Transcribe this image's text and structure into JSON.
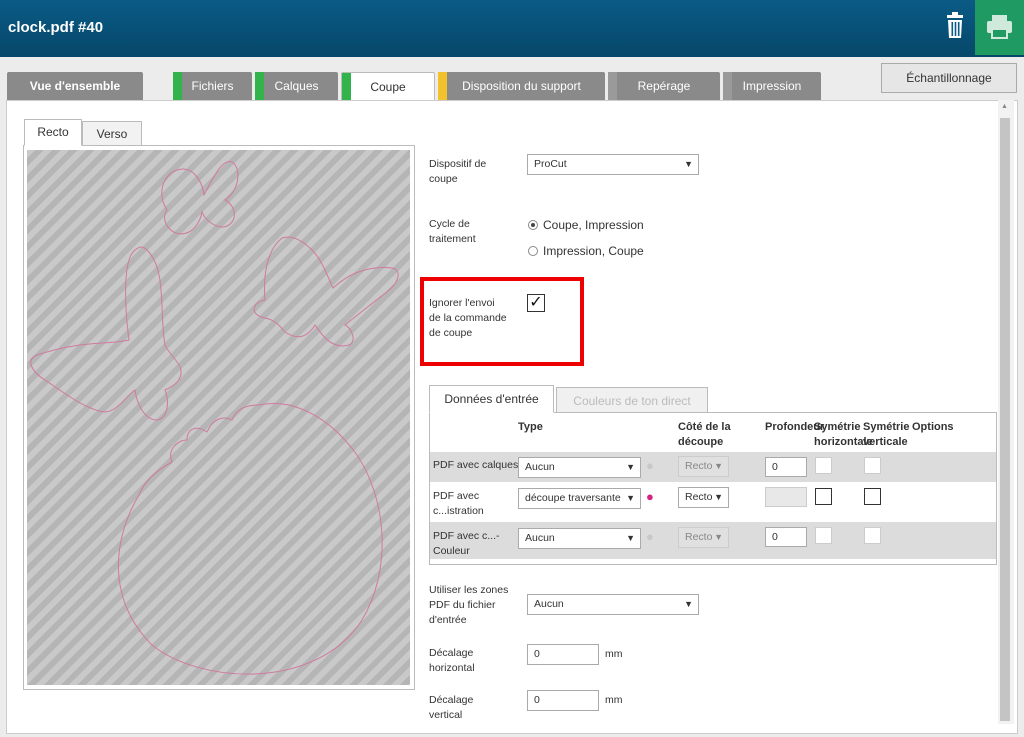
{
  "header": {
    "title": "clock.pdf #40"
  },
  "tabs": [
    {
      "label": "Vue d'ensemble",
      "bar": ""
    },
    {
      "label": "Fichiers",
      "bar": "#33b34b"
    },
    {
      "label": "Calques",
      "bar": "#33b34b"
    },
    {
      "label": "Coupe",
      "bar": "#33b34b"
    },
    {
      "label": "Disposition du support",
      "bar": "#f2c12e"
    },
    {
      "label": "Repérage",
      "bar": "#9a9a9a"
    },
    {
      "label": "Impression",
      "bar": "#9a9a9a"
    }
  ],
  "sample_button": "Échantillonnage",
  "preview_tabs": [
    "Recto",
    "Verso"
  ],
  "device": {
    "label": "Dispositif de coupe",
    "value": "ProCut"
  },
  "cycle": {
    "label": "Cycle de traitement",
    "options": [
      "Coupe, Impression",
      "Impression, Coupe"
    ],
    "selected": 0
  },
  "ignore_cmd": {
    "label": "Ignorer l'envoi de la commande de coupe",
    "checked": true,
    "mark": "✓"
  },
  "data_tabs": [
    "Données d'entrée",
    "Couleurs de ton direct"
  ],
  "table": {
    "headers": {
      "type": "Type",
      "side": "Côté de la découpe",
      "depth": "Profondeur",
      "sym_h": "Symétrie horizontale",
      "sym_v": "Symétrie verticale",
      "options": "Options"
    },
    "rows": [
      {
        "name": "PDF avec calques",
        "type": "Aucun",
        "side": "Recto",
        "depth": "0",
        "drop_color": "#c8c8c8"
      },
      {
        "name": "PDF avec c...istration",
        "type": "découpe traversante",
        "side": "Recto",
        "depth": "",
        "drop_color": "#d6237f"
      },
      {
        "name": "PDF avec c...-Couleur",
        "type": "Aucun",
        "side": "Recto",
        "depth": "0",
        "drop_color": "#c8c8c8"
      }
    ]
  },
  "zones": {
    "label": "Utiliser les zones PDF du fichier d'entrée",
    "value": "Aucun"
  },
  "offset_h": {
    "label": "Décalage horizontal",
    "value": "0",
    "unit": "mm"
  },
  "offset_v": {
    "label": "Décalage vertical",
    "value": "0",
    "unit": "mm"
  },
  "colors": {
    "header_bg": "#064769",
    "print_btn": "#1f9a63",
    "highlight": "#e00000",
    "cut_line": "#d07a9e"
  }
}
